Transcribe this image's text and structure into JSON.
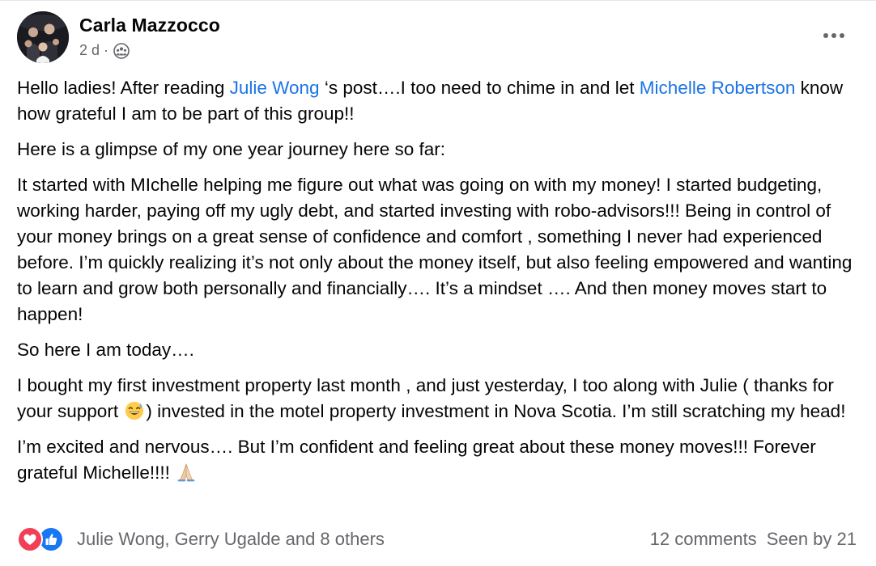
{
  "post": {
    "author": "Carla Mazzocco",
    "time": "2 d",
    "separator": "·",
    "avatar_icon": "profile-photo-group",
    "privacy_icon": "group-privacy-icon",
    "more_icon": "more-options-icon"
  },
  "body": {
    "p1": {
      "t1": "Hello ladies! After reading ",
      "mention1": "Julie Wong",
      "t2": " ‘s post….I too need to chime in and let ",
      "mention2": "Michelle Robertson",
      "t3": " know how grateful I am to be part of this group!!"
    },
    "p2": "Here is a glimpse of my one year journey here so far:",
    "p3": "It started with MIchelle helping me figure out what was going on with my money! I started budgeting, working harder, paying off my ugly debt, and started investing with robo-advisors!!! Being in control of your money brings on a great sense of confidence and comfort , something I never had experienced before. I’m quickly realizing it’s not only about the money itself, but also feeling empowered and wanting to learn and grow both personally and financially…. It’s a mindset …. And then money moves start to happen!",
    "p4": "So here I am today….",
    "p5": {
      "t1": "I bought my first investment property last month , and just yesterday, I too along with Julie ( thanks for your support ",
      "t2": ") invested in the motel property investment in Nova Scotia. I’m still scratching my head!"
    },
    "p6": {
      "t1": "I’m excited and nervous…. But I’m confident and feeling great about these money moves!!! Forever grateful Michelle!!!! "
    },
    "emoji1": "grinning-sweat-emoji",
    "emoji2": "folded-hands-emoji"
  },
  "footer": {
    "reactors": "Julie Wong, Gerry Ugalde and 8 others",
    "comments": "12 comments",
    "seen": "Seen by 21",
    "reaction_icons": [
      "love-reaction-icon",
      "like-reaction-icon"
    ],
    "colors": {
      "love": "#f33e58",
      "like": "#1877f2",
      "mention": "#1b74e4",
      "meta": "#65676b"
    }
  }
}
